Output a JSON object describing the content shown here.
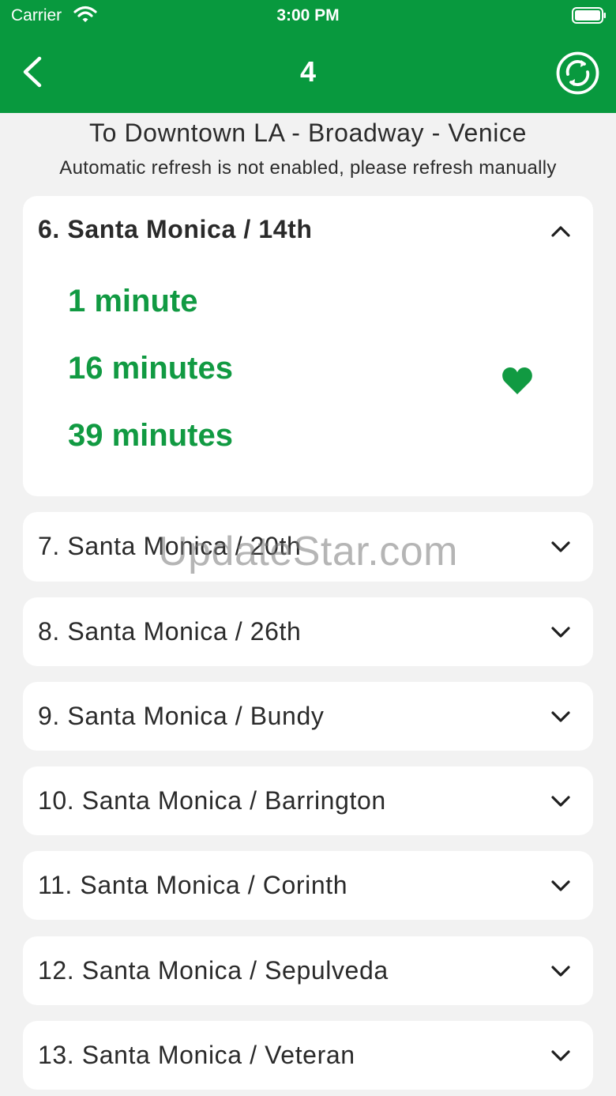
{
  "status_bar": {
    "carrier": "Carrier",
    "time": "3:00 PM",
    "icons": [
      "wifi-icon",
      "battery-icon"
    ]
  },
  "nav": {
    "title": "4",
    "back_icon": "chevron-left-icon",
    "refresh_icon": "refresh-icon"
  },
  "route": {
    "direction": "To Downtown LA - Broadway - Venice",
    "refresh_notice": "Automatic refresh is not enabled, please refresh manually"
  },
  "stops": [
    {
      "label": "6. Santa Monica / 14th",
      "expanded": true
    },
    {
      "label": "7. Santa Monica / 20th",
      "expanded": false
    },
    {
      "label": "8. Santa Monica / 26th",
      "expanded": false
    },
    {
      "label": "9. Santa Monica / Bundy",
      "expanded": false
    },
    {
      "label": "10. Santa Monica / Barrington",
      "expanded": false
    },
    {
      "label": "11. Santa Monica / Corinth",
      "expanded": false
    },
    {
      "label": "12. Santa Monica / Sepulveda",
      "expanded": false
    },
    {
      "label": "13. Santa Monica / Veteran",
      "expanded": false
    }
  ],
  "expanded_stop": {
    "arrivals": [
      "1 minute",
      "16 minutes",
      "39 minutes"
    ],
    "favorite_icon": "heart-icon",
    "favorited": true
  },
  "watermark": "UpdateStar.com",
  "colors": {
    "brand_green": "#08993e",
    "arrival_green": "#119a42",
    "background": "#f2f2f2",
    "card": "#ffffff"
  }
}
